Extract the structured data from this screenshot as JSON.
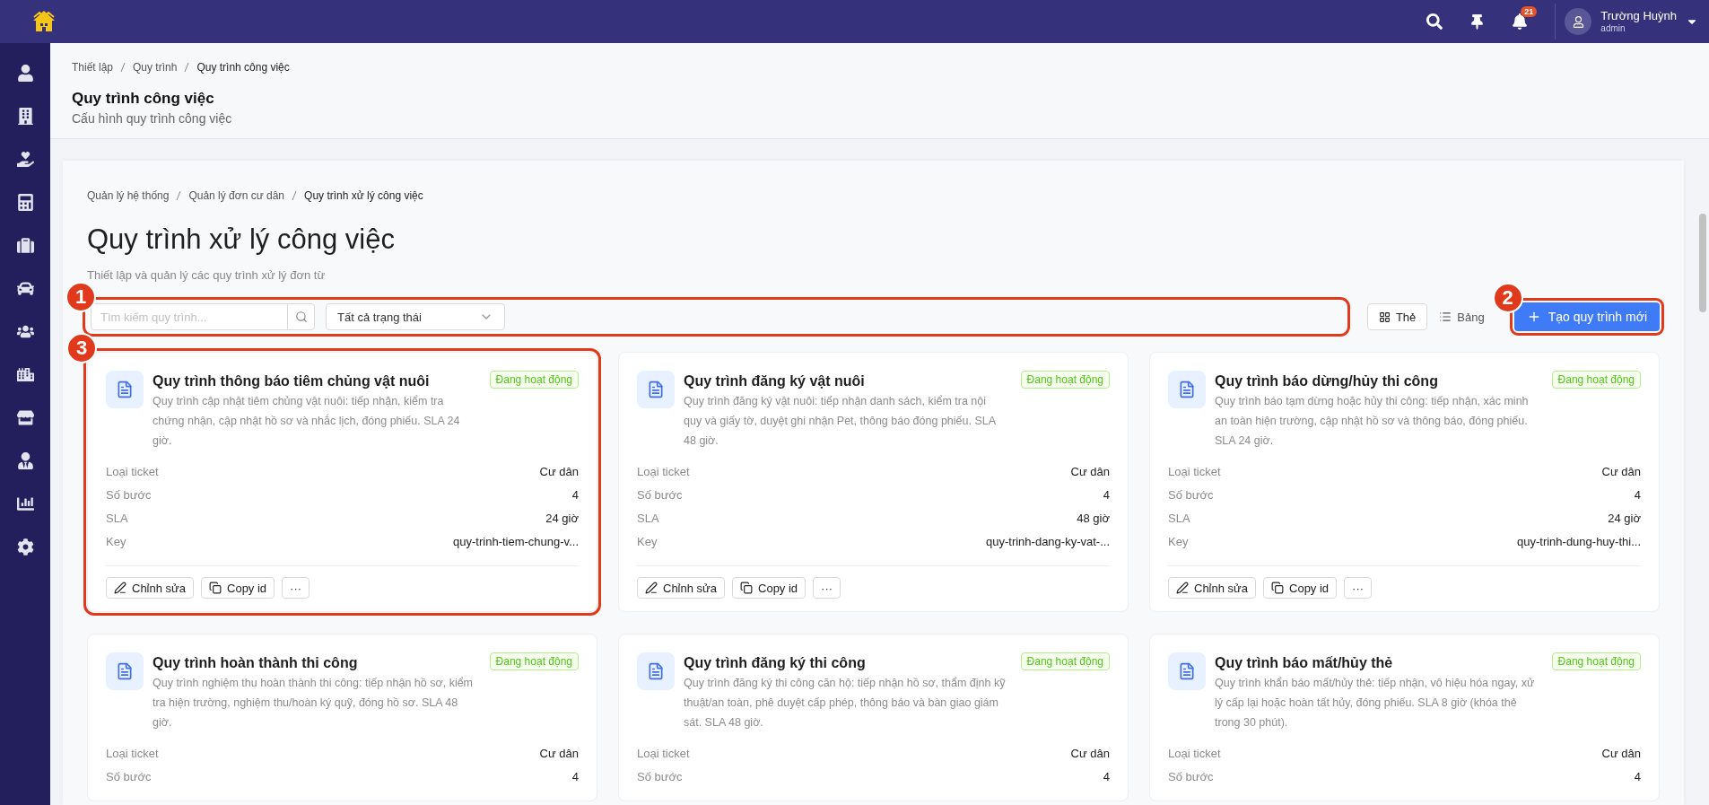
{
  "topbar": {
    "notification_count": "21",
    "user": {
      "name": "Trường Huỳnh",
      "role": "admin"
    }
  },
  "page_header": {
    "breadcrumb": [
      "Thiết lập",
      "Quy trình",
      "Quy trình công việc"
    ],
    "title": "Quy trình công việc",
    "subtitle": "Cấu hình quy trình công việc"
  },
  "panel": {
    "breadcrumb": [
      "Quản lý hệ thống",
      "Quản lý đơn cư dân",
      "Quy trình xử lý công việc"
    ],
    "title": "Quy trình xử lý công việc",
    "subtitle": "Thiết lập và quản lý các quy trình xử lý đơn từ",
    "filters": {
      "callout": "1",
      "search": {
        "placeholder": "Tìm kiếm quy trình..."
      },
      "status_filter": {
        "value": "Tất cả trạng thái"
      }
    },
    "view_modes": [
      {
        "kind": "grid",
        "label": "Thẻ",
        "selected": true
      },
      {
        "kind": "list",
        "label": "Bảng",
        "selected": false
      }
    ],
    "create_button": {
      "label": "Tạo quy trình mới",
      "callout": "2"
    },
    "cards": [
      {
        "callout": "3",
        "title": "Quy trình thông báo tiêm chủng vật nuôi",
        "description": "Quy trình cập nhật tiêm chủng vật nuôi: tiếp nhận, kiểm tra chứng nhận, cập nhật hồ sơ và nhắc lịch, đóng phiếu. SLA 24 giờ.",
        "status": "Đang hoạt động",
        "fields": [
          {
            "label": "Loại ticket",
            "value": "Cư dân"
          },
          {
            "label": "Số bước",
            "value": "4"
          },
          {
            "label": "SLA",
            "value": "24 giờ"
          },
          {
            "label": "Key",
            "value": "quy-trinh-tiem-chung-v..."
          }
        ],
        "actions": [
          {
            "kind": "edit",
            "label": "Chỉnh sửa"
          },
          {
            "kind": "copy",
            "label": "Copy id"
          },
          {
            "kind": "more",
            "label": "···"
          }
        ]
      },
      {
        "title": "Quy trình đăng ký vật nuôi",
        "description": "Quy trình đăng ký vật nuôi: tiếp nhận danh sách, kiểm tra nội quy và giấy tờ, duyệt ghi nhận Pet, thông báo đóng phiếu. SLA 48 giờ.",
        "status": "Đang hoạt động",
        "fields": [
          {
            "label": "Loại ticket",
            "value": "Cư dân"
          },
          {
            "label": "Số bước",
            "value": "4"
          },
          {
            "label": "SLA",
            "value": "48 giờ"
          },
          {
            "label": "Key",
            "value": "quy-trinh-dang-ky-vat-..."
          }
        ],
        "actions": [
          {
            "kind": "edit",
            "label": "Chỉnh sửa"
          },
          {
            "kind": "copy",
            "label": "Copy id"
          },
          {
            "kind": "more",
            "label": "···"
          }
        ]
      },
      {
        "title": "Quy trình báo dừng/hủy thi công",
        "description": "Quy trình báo tạm dừng hoặc hủy thi công: tiếp nhận, xác minh an toàn hiện trường, cập nhật hồ sơ và thông báo, đóng phiếu. SLA 24 giờ.",
        "status": "Đang hoạt động",
        "fields": [
          {
            "label": "Loại ticket",
            "value": "Cư dân"
          },
          {
            "label": "Số bước",
            "value": "4"
          },
          {
            "label": "SLA",
            "value": "24 giờ"
          },
          {
            "label": "Key",
            "value": "quy-trinh-dung-huy-thi..."
          }
        ],
        "actions": [
          {
            "kind": "edit",
            "label": "Chỉnh sửa"
          },
          {
            "kind": "copy",
            "label": "Copy id"
          },
          {
            "kind": "more",
            "label": "···"
          }
        ]
      },
      {
        "title": "Quy trình hoàn thành thi công",
        "description": "Quy trình nghiệm thu hoàn thành thi công: tiếp nhận hồ sơ, kiểm tra hiện trường, nghiệm thu/hoàn ký quỹ, đóng hồ sơ. SLA 48 giờ.",
        "status": "Đang hoạt động",
        "fields": [
          {
            "label": "Loại ticket",
            "value": "Cư dân"
          },
          {
            "label": "Số bước",
            "value": "4"
          }
        ]
      },
      {
        "title": "Quy trình đăng ký thi công",
        "description": "Quy trình đăng ký thi công căn hộ: tiếp nhận hồ sơ, thẩm định kỹ thuật/an toàn, phê duyệt cấp phép, thông báo và bàn giao giám sát. SLA 48 giờ.",
        "status": "Đang hoạt động",
        "fields": [
          {
            "label": "Loại ticket",
            "value": "Cư dân"
          },
          {
            "label": "Số bước",
            "value": "4"
          }
        ]
      },
      {
        "title": "Quy trình báo mất/hủy thẻ",
        "description": "Quy trình khẩn báo mất/hủy thẻ: tiếp nhận, vô hiệu hóa ngay, xử lý cấp lại hoặc hoàn tất hủy, đóng phiếu. SLA 8 giờ (khóa thẻ trong 30 phút).",
        "status": "Đang hoạt động",
        "fields": [
          {
            "label": "Loại ticket",
            "value": "Cư dân"
          },
          {
            "label": "Số bước",
            "value": "4"
          }
        ]
      }
    ]
  }
}
